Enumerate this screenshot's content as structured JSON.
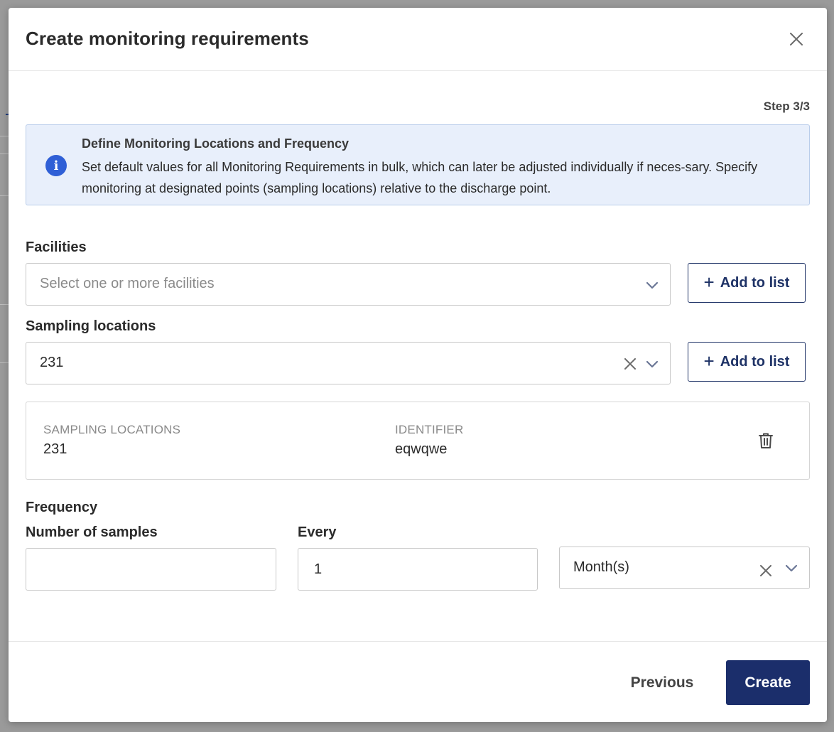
{
  "modal": {
    "title": "Create monitoring requirements",
    "step": "Step 3/3"
  },
  "info": {
    "title": "Define Monitoring Locations and Frequency",
    "text": "Set default values for all Monitoring Requirements in bulk, which can later be adjusted individually if neces-sary. Specify monitoring at designated points (sampling locations) relative to the discharge point."
  },
  "facilities": {
    "label": "Facilities",
    "placeholder": "Select one or more facilities",
    "add_label": "Add to list"
  },
  "sampling": {
    "label": "Sampling locations",
    "value": "231",
    "add_label": "Add to list"
  },
  "locations_card": {
    "col1_header": "SAMPLING LOCATIONS",
    "col1_value": "231",
    "col2_header": "IDENTIFIER",
    "col2_value": "eqwqwe"
  },
  "frequency": {
    "label": "Frequency",
    "samples_label": "Number of samples",
    "samples_value": "",
    "every_label": "Every",
    "every_value": "1",
    "unit_value": "Month(s)"
  },
  "footer": {
    "previous_label": "Previous",
    "create_label": "Create"
  },
  "colors": {
    "primary": "#1b2e6b",
    "info_bg": "#e8effb",
    "info_icon": "#2f5fd6"
  }
}
